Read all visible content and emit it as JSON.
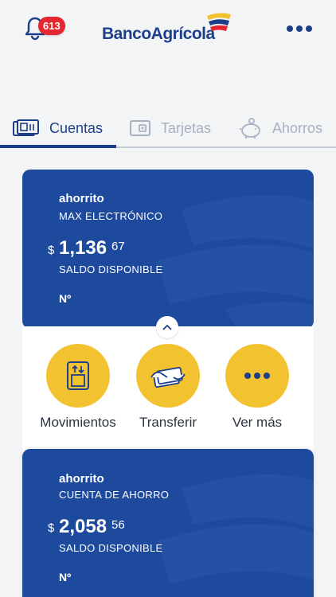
{
  "header": {
    "notification_count": "613",
    "brand_name": "BancoAgrícola",
    "brand_colors": {
      "blue": "#1d3f8a",
      "yellow": "#f2c230",
      "red": "#e3262f"
    }
  },
  "tabs": [
    {
      "label": "Cuentas",
      "icon": "accounts-icon",
      "active": true
    },
    {
      "label": "Tarjetas",
      "icon": "card-icon",
      "active": false
    },
    {
      "label": "Ahorros",
      "icon": "piggy-bank-icon",
      "active": false
    }
  ],
  "accounts": [
    {
      "alias": "ahorrito",
      "product": "MAX ELECTRÓNICO",
      "currency": "$",
      "amount": "1,136",
      "cents": "67",
      "balance_label": "SALDO DISPONIBLE",
      "number_label": "Nº"
    },
    {
      "alias": "ahorrito",
      "product": "CUENTA DE AHORRO",
      "currency": "$",
      "amount": "2,058",
      "cents": "56",
      "balance_label": "SALDO DISPONIBLE",
      "number_label": "Nº"
    }
  ],
  "actions": [
    {
      "label": "Movimientos",
      "icon": "movements-icon"
    },
    {
      "label": "Transferir",
      "icon": "transfer-icon"
    },
    {
      "label": "Ver más",
      "icon": "more-icon"
    }
  ]
}
